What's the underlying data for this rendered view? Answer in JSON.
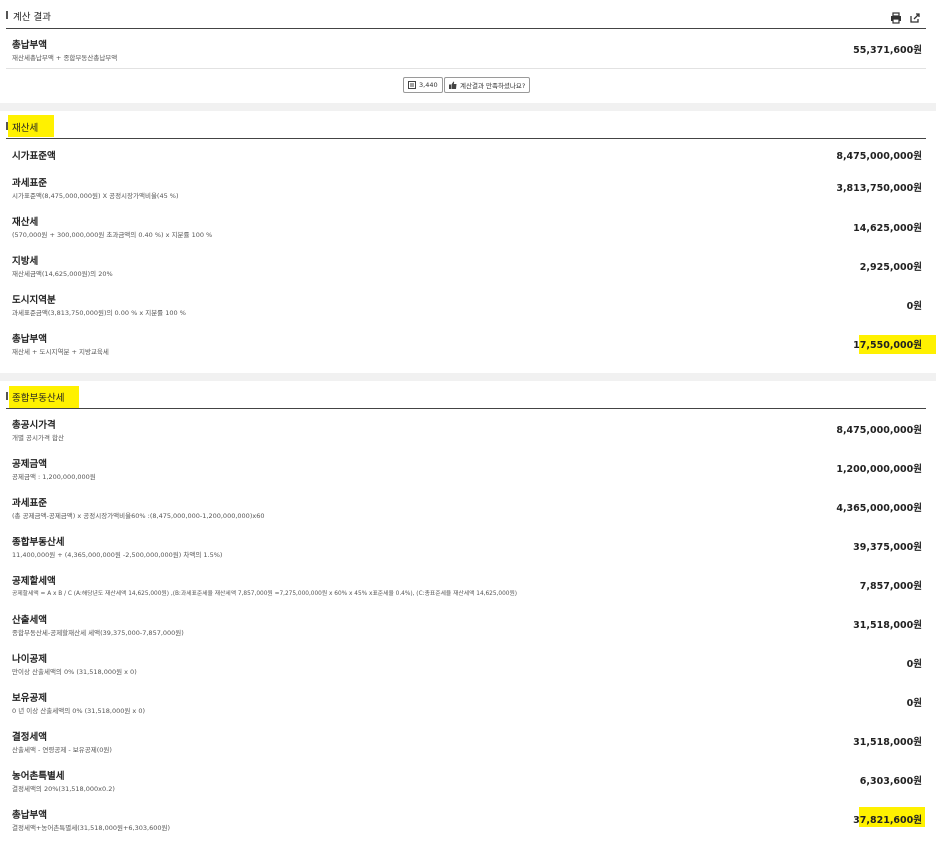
{
  "colors": {
    "highlight": "#fff100",
    "divider": "#e2e2e2",
    "text": "#222222",
    "background": "#f1f1f1"
  },
  "result": {
    "title": "계산 결과",
    "print_icon": "print-icon",
    "share_icon": "share-icon",
    "total_label": "총납부액",
    "total_sub": "재산세총납부액 + 종합부동산총납부액",
    "total_value": "55,371,600원",
    "count_value": "3,440",
    "count_icon": "calculator-icon",
    "feedback_label": "계산결과 만족하셨나요?",
    "feedback_icon": "thumbs-up-icon"
  },
  "property_tax": {
    "title": "재산세",
    "rows": [
      {
        "label": "시가표준액",
        "sub": "",
        "value": "8,475,000,000원"
      },
      {
        "label": "과세표준",
        "sub": "시가표준액(8,475,000,000원) X 공정시장가액비율(45 %)",
        "value": "3,813,750,000원"
      },
      {
        "label": "재산세",
        "sub": "(570,000원 + 300,000,000원 초과금액의 0.40 %) x 지분률 100 %",
        "value": "14,625,000원"
      },
      {
        "label": "지방세",
        "sub": "재산세금액(14,625,000원)의 20%",
        "value": "2,925,000원"
      },
      {
        "label": "도시지역분",
        "sub": "과세표준금액(3,813,750,000원)의 0.00 % x 지분률 100 %",
        "value": "0원"
      },
      {
        "label": "총납부액",
        "sub": "재산세 + 도시지역분 + 지방교육세",
        "value": "17,550,000원"
      }
    ]
  },
  "comprehensive_tax": {
    "title": "종합부동산세",
    "rows": [
      {
        "label": "총공시가격",
        "sub": "개별 공시가격 합산",
        "value": "8,475,000,000원"
      },
      {
        "label": "공제금액",
        "sub": "공제금액 : 1,200,000,000원",
        "value": "1,200,000,000원"
      },
      {
        "label": "과세표준",
        "sub": "(총 공제금액-공제금액) x 공정시장가액비율60% :(8,475,000,000-1,200,000,000)x60",
        "value": "4,365,000,000원"
      },
      {
        "label": "종합부동산세",
        "sub": "11,400,000원 + (4,365,000,000원 -2,500,000,000원) 차액의 1.5%)",
        "value": "39,375,000원"
      },
      {
        "label": "공제할세액",
        "sub": "공제할세액 = A x B / C (A:해당년도 재산세액 14,625,000원) ,(B:과세표준세율 재산세액 7,857,000원 =7,275,000,000원 x 60% x 45% x표준세율 0.4%), (C:총표준세율 재산세액 14,625,000원)",
        "value": "7,857,000원"
      },
      {
        "label": "산출세액",
        "sub": "종합부동산세-공제할재산세 세액(39,375,000-7,857,000원)",
        "value": "31,518,000원"
      },
      {
        "label": "나이공제",
        "sub": "만이상 산출세액의 0% (31,518,000원 x 0)",
        "value": "0원"
      },
      {
        "label": "보유공제",
        "sub": "0 년 이상 산출세액의 0% (31,518,000원 x 0)",
        "value": "0원"
      },
      {
        "label": "결정세액",
        "sub": "산출세액 - 연령공제 - 보유공제(0원)",
        "value": "31,518,000원"
      },
      {
        "label": "농어촌특별세",
        "sub": "결정세액의 20%(31,518,000x0.2)",
        "value": "6,303,600원"
      },
      {
        "label": "총납부액",
        "sub": "결정세액+농어촌특별세(31,518,000원+6,303,600원)",
        "value": "37,821,600원"
      }
    ]
  }
}
